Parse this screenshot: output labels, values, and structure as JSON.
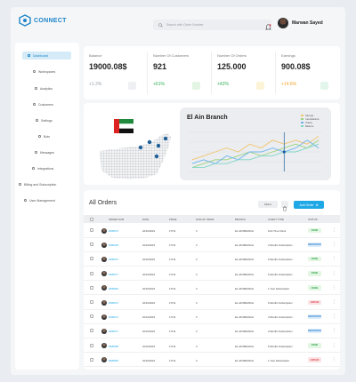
{
  "brand": {
    "name": "CONNECT"
  },
  "search": {
    "placeholder": "Search with Order Number"
  },
  "user": {
    "name": "Marwan Sayed"
  },
  "sidebar": {
    "items": [
      {
        "label": "Dashboard",
        "active": true
      },
      {
        "label": "Workspaces"
      },
      {
        "label": "Analytics"
      },
      {
        "label": "Customers"
      },
      {
        "label": "Settings"
      },
      {
        "label": "Bots"
      },
      {
        "label": "Messages"
      },
      {
        "label": "Integrations"
      },
      {
        "label": "Billing and Subscription"
      },
      {
        "label": "User Management"
      }
    ]
  },
  "stats": [
    {
      "label": "Balance",
      "value": "19000.08$",
      "change": "+1.2%",
      "change_color": "#9aa0a8",
      "icon_color": "#eef0f3"
    },
    {
      "label": "Number Of Customers",
      "value": "921",
      "change": "+61%",
      "change_color": "#2fae57",
      "icon_color": "#e3f6e3"
    },
    {
      "label": "Number Of Orders",
      "value": "125.000",
      "change": "+42%",
      "change_color": "#2fae57",
      "icon_color": "#fdf3d6"
    },
    {
      "label": "Earnings",
      "value": "900.08$",
      "change": "+14.6%",
      "change_color": "#f2a227",
      "icon_color": "#e3f6ec"
    }
  ],
  "branch": {
    "title": "El Ain Branch"
  },
  "chart_data": {
    "type": "line",
    "title": "El Ain Branch",
    "series": [
      {
        "name": "Savings",
        "color": "#f2c46d",
        "values": [
          3,
          4,
          5,
          6,
          5,
          7,
          6,
          8,
          7,
          8,
          7,
          9
        ]
      },
      {
        "name": "Cancellations",
        "color": "#9bd37a",
        "values": [
          1,
          2,
          3,
          3,
          4,
          5,
          4,
          5,
          6,
          7,
          6,
          8
        ]
      },
      {
        "name": "Orders",
        "color": "#6fb3f0",
        "values": [
          2,
          3,
          2,
          4,
          3,
          5,
          5,
          6,
          5,
          6,
          8,
          6
        ]
      },
      {
        "name": "Balance",
        "color": "#7ed6c8",
        "values": [
          1,
          1,
          2,
          2,
          3,
          3,
          4,
          4,
          5,
          5,
          6,
          7
        ]
      }
    ],
    "highlight_index": 8
  },
  "orders": {
    "title": "All Orders",
    "filter_label": "Filters",
    "add_label": "Add Order",
    "columns": [
      "ORDER NUM",
      "DATE",
      "PRICE",
      "NUM OF ITEMS",
      "BRANCH",
      "CLIENT TYPE",
      "STATUS"
    ],
    "rows": [
      {
        "num": "#395672",
        "date": "22/10/2023",
        "price": "170 $",
        "items": "3",
        "branch": "EL AIN BRANCH",
        "client": "First Time Client",
        "status": "DONE",
        "status_class": "done"
      },
      {
        "num": "#395228",
        "date": "22/10/2023",
        "price": "170 $",
        "items": "3",
        "branch": "EL AIN BRANCH",
        "client": "3 Months Subscription",
        "status": "DEPOSITED",
        "status_class": "deposited"
      },
      {
        "num": "#395672",
        "date": "22/10/2023",
        "price": "170 $",
        "items": "3",
        "branch": "EL AIN BRANCH",
        "client": "6 Months Subscription",
        "status": "DONE",
        "status_class": "done"
      },
      {
        "num": "#395577",
        "date": "22/10/2023",
        "price": "170 $",
        "items": "3",
        "branch": "EL AIN BRANCH",
        "client": "6 Months Subscription",
        "status": "DONE",
        "status_class": "done"
      },
      {
        "num": "#395690",
        "date": "22/10/2023",
        "price": "170 $",
        "items": "3",
        "branch": "EL AIN BRANCH",
        "client": "1 Year Subscription",
        "status": "DONE",
        "status_class": "done"
      },
      {
        "num": "#395672",
        "date": "22/10/2023",
        "price": "170 $",
        "items": "3",
        "branch": "EL AIN BRANCH",
        "client": "6 Months Subscription",
        "status": "UNPAID",
        "status_class": "unpaid"
      },
      {
        "num": "#395672",
        "date": "22/10/2023",
        "price": "170 $",
        "items": "3",
        "branch": "EL AIN BRANCH",
        "client": "3 Months Subscription",
        "status": "DEPOSITED",
        "status_class": "deposited"
      },
      {
        "num": "#395671",
        "date": "22/10/2023",
        "price": "170 $",
        "items": "3",
        "branch": "EL AIN BRANCH",
        "client": "3 Months Subscription",
        "status": "DEPOSITED",
        "status_class": "deposited"
      },
      {
        "num": "#395698",
        "date": "22/10/2023",
        "price": "170 $",
        "items": "3",
        "branch": "EL AIN BRANCH",
        "client": "6 Months Subscription",
        "status": "DONE",
        "status_class": "done"
      },
      {
        "num": "#395659",
        "date": "22/10/2023",
        "price": "170 $",
        "items": "3",
        "branch": "EL AIN BRANCH",
        "client": "1 Year Subscription",
        "status": "UNPAID",
        "status_class": "unpaid"
      }
    ]
  }
}
